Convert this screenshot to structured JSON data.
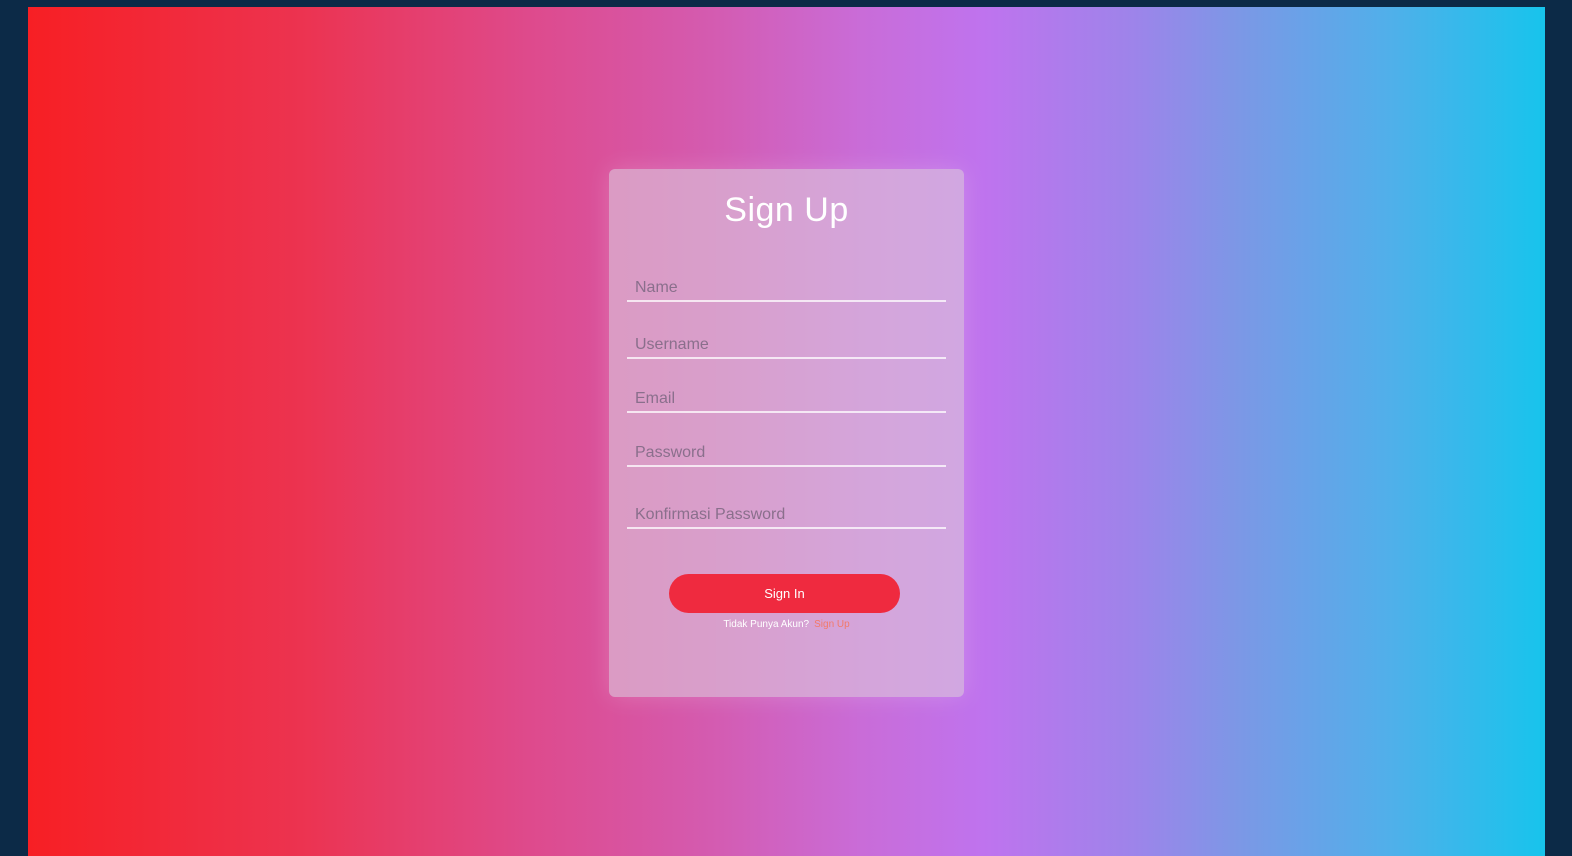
{
  "form": {
    "title": "Sign Up",
    "fields": [
      {
        "placeholder": "Name",
        "value": ""
      },
      {
        "placeholder": "Username",
        "value": ""
      },
      {
        "placeholder": "Email",
        "value": ""
      },
      {
        "placeholder": "Password",
        "value": ""
      },
      {
        "placeholder": "Konfirmasi Password",
        "value": ""
      }
    ],
    "submit_label": "Sign In",
    "footer_text": "Tidak Punya Akun?",
    "footer_link": "Sign Up"
  },
  "colors": {
    "background": "#0c2a47",
    "gradient_start": "#f71f24",
    "gradient_mid": "#bf73ee",
    "gradient_end": "#17c4ec",
    "button": "#ef2a3f",
    "link": "#f27a6a"
  }
}
